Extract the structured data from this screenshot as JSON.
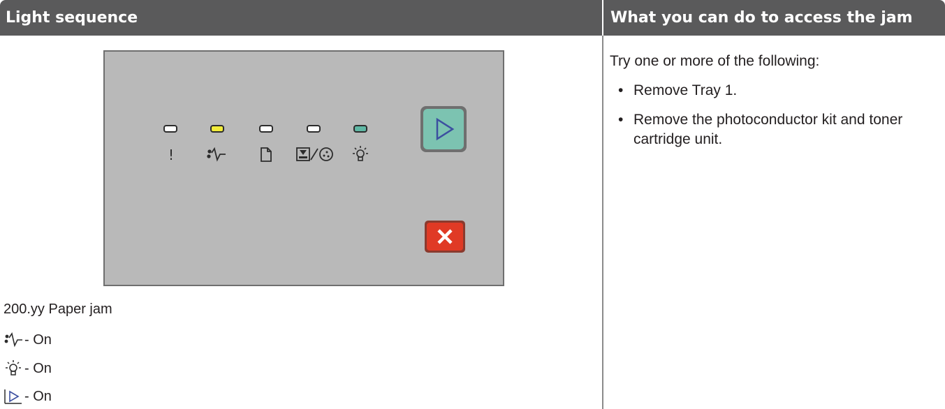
{
  "table": {
    "col1_header": "Light sequence",
    "col2_header": "What you can do to access the jam"
  },
  "panel": {
    "leds": [
      {
        "symbol": "exclamation-icon",
        "color": "#ffffff",
        "state": "off"
      },
      {
        "symbol": "paper-jam-icon",
        "color": "#f2ec3a",
        "state": "on"
      },
      {
        "symbol": "load-paper-icon",
        "color": "#ffffff",
        "state": "off"
      },
      {
        "symbol": "toner-photoconductor-icon",
        "color": "#ffffff",
        "state": "off"
      },
      {
        "symbol": "ready-light-icon",
        "color": "#5fb7a4",
        "state": "on"
      }
    ],
    "buttons": [
      {
        "name": "continue-button",
        "icon": "play-icon",
        "color": "#7cc3b1"
      },
      {
        "name": "cancel-button",
        "icon": "x-icon",
        "color": "#e03a25"
      }
    ]
  },
  "caption": "200.yy Paper jam",
  "states": [
    {
      "icon": "paper-jam-icon",
      "text": "- On"
    },
    {
      "icon": "ready-light-icon",
      "text": "- On"
    },
    {
      "icon": "continue-icon",
      "text": "- On"
    }
  ],
  "actions": {
    "intro": "Try one or more of the following:",
    "items": [
      "Remove Tray 1.",
      "Remove the photoconductor kit and toner cartridge unit."
    ],
    "bullet": "•"
  }
}
